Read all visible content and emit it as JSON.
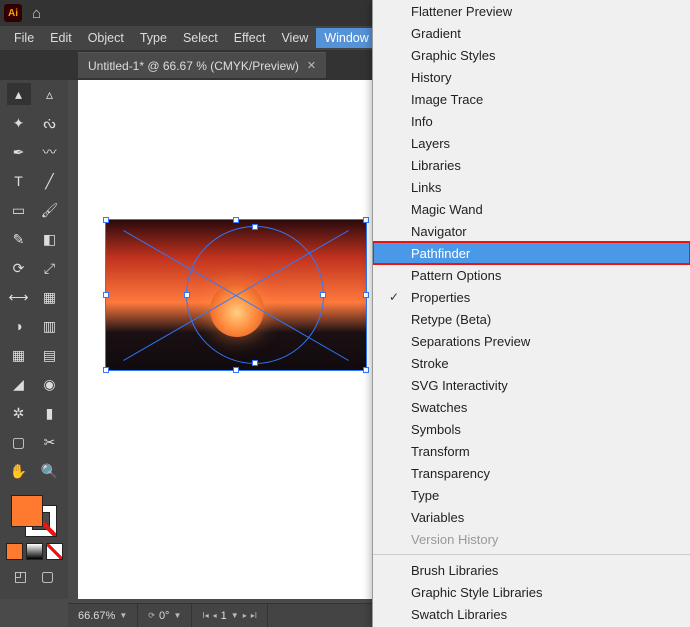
{
  "menubar": [
    "File",
    "Edit",
    "Object",
    "Type",
    "Select",
    "Effect",
    "View",
    "Window"
  ],
  "active_menu_index": 7,
  "tab": {
    "title": "Untitled-1* @ 66.67 % (CMYK/Preview)"
  },
  "status": {
    "zoom": "66.67%",
    "rot_label": "0°",
    "art_label": "1"
  },
  "colors": {
    "fill": "#ff7a2f"
  },
  "window_menu": [
    {
      "label": "Flattener Preview"
    },
    {
      "label": "Gradient"
    },
    {
      "label": "Graphic Styles"
    },
    {
      "label": "History"
    },
    {
      "label": "Image Trace"
    },
    {
      "label": "Info"
    },
    {
      "label": "Layers"
    },
    {
      "label": "Libraries"
    },
    {
      "label": "Links"
    },
    {
      "label": "Magic Wand"
    },
    {
      "label": "Navigator"
    },
    {
      "label": "Pathfinder",
      "selected": true
    },
    {
      "label": "Pattern Options"
    },
    {
      "label": "Properties",
      "checked": true
    },
    {
      "label": "Retype (Beta)"
    },
    {
      "label": "Separations Preview"
    },
    {
      "label": "Stroke"
    },
    {
      "label": "SVG Interactivity"
    },
    {
      "label": "Swatches"
    },
    {
      "label": "Symbols"
    },
    {
      "label": "Transform"
    },
    {
      "label": "Transparency"
    },
    {
      "label": "Type"
    },
    {
      "label": "Variables"
    },
    {
      "label": "Version History",
      "disabled": true
    },
    {
      "sep": true
    },
    {
      "label": "Brush Libraries"
    },
    {
      "label": "Graphic Style Libraries"
    },
    {
      "label": "Swatch Libraries"
    }
  ]
}
